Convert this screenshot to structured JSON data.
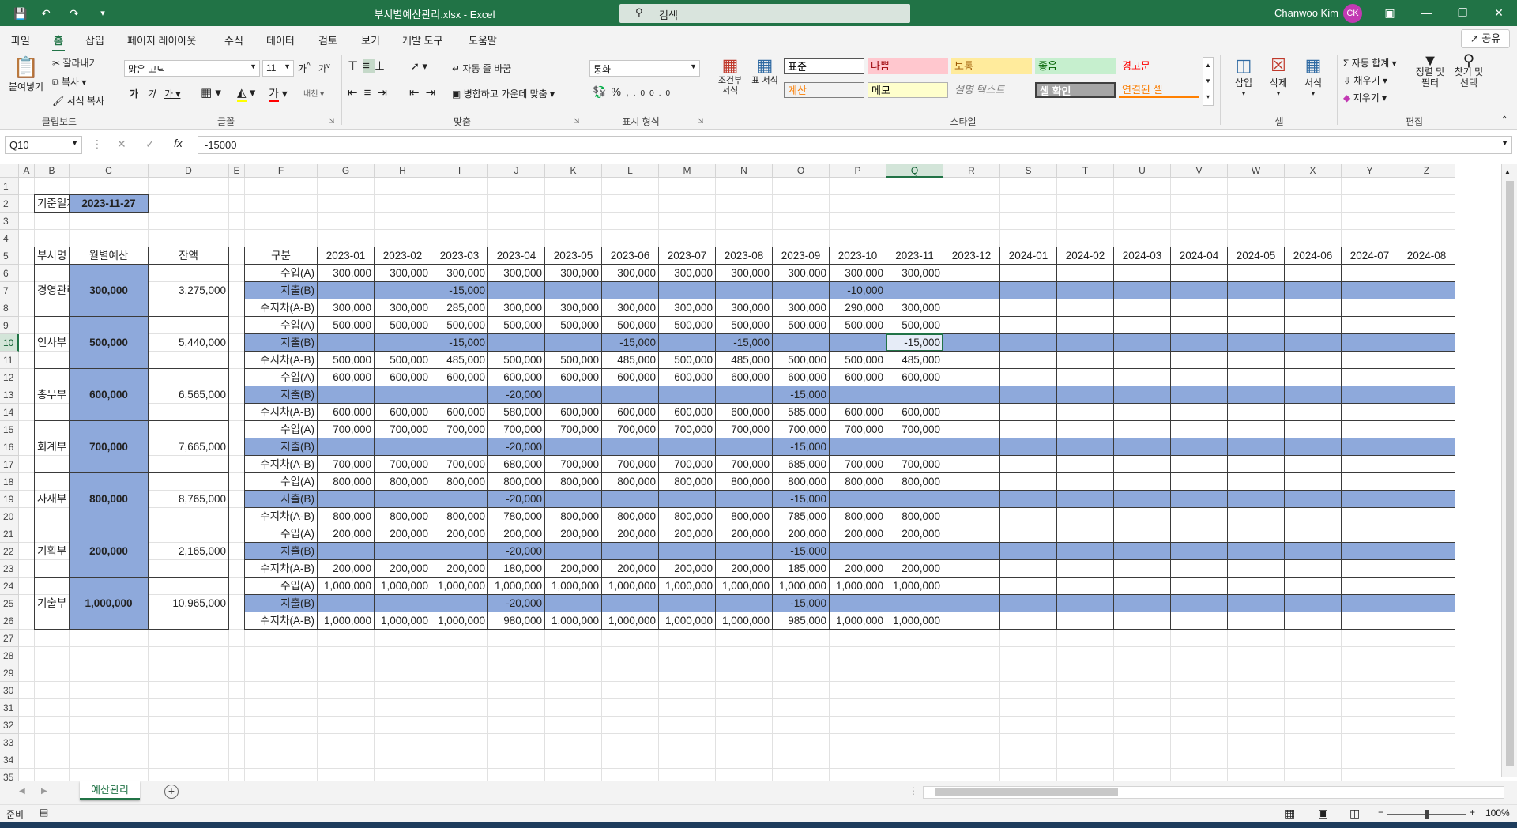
{
  "titlebar": {
    "title": "부서별예산관리.xlsx  -  Excel",
    "search_placeholder": "검색",
    "user_name": "Chanwoo Kim",
    "user_initials": "CK"
  },
  "ribbon_tabs": [
    "파일",
    "홈",
    "삽입",
    "페이지 레이아웃",
    "수식",
    "데이터",
    "검토",
    "보기",
    "개발 도구",
    "도움말"
  ],
  "share_label": "공유",
  "clipboard": {
    "paste": "붙여넣기",
    "cut": "잘라내기",
    "copy": "복사",
    "format_painter": "서식 복사",
    "label": "클립보드"
  },
  "font": {
    "name": "맑은 고딕",
    "size": "11",
    "label": "글꼴"
  },
  "alignment": {
    "wrap": "자동 줄 바꿈",
    "merge": "병합하고 가운데 맞춤",
    "label": "맞춤"
  },
  "number": {
    "format": "통화",
    "label": "표시 형식"
  },
  "styles": {
    "conditional": "조건부 서식",
    "table": "표 서식",
    "label": "스타일",
    "cells": [
      {
        "text": "표준",
        "bg": "#ffffff",
        "color": "#000000"
      },
      {
        "text": "나쁨",
        "bg": "#ffc7ce",
        "color": "#9c0006"
      },
      {
        "text": "보통",
        "bg": "#ffeb9c",
        "color": "#9c5700"
      },
      {
        "text": "좋음",
        "bg": "#c6efce",
        "color": "#006100"
      },
      {
        "text": "경고문",
        "bg": "#f3f3f3",
        "color": "#ff0000"
      },
      {
        "text": "계산",
        "bg": "#f2f2f2",
        "color": "#fa7d00"
      },
      {
        "text": "메모",
        "bg": "#ffffcc",
        "color": "#000000"
      },
      {
        "text": "설명 텍스트",
        "bg": "#f3f3f3",
        "color": "#7f7f7f"
      },
      {
        "text": "셀 확인",
        "bg": "#a5a5a5",
        "color": "#ffffff"
      },
      {
        "text": "연결된 셀",
        "bg": "#f3f3f3",
        "color": "#fa7d00"
      }
    ]
  },
  "cells_group": {
    "insert": "삽입",
    "delete": "삭제",
    "format": "서식",
    "label": "셀"
  },
  "editing": {
    "autosum": "자동 합계",
    "fill": "채우기",
    "clear": "지우기",
    "sort": "정렬 및 필터",
    "find": "찾기 및 선택",
    "label": "편집"
  },
  "formula_bar": {
    "name_box": "Q10",
    "formula": "-15000"
  },
  "columns": [
    "A",
    "B",
    "C",
    "D",
    "E",
    "F",
    "G",
    "H",
    "I",
    "J",
    "K",
    "L",
    "M",
    "N",
    "O",
    "P",
    "Q",
    "R",
    "S",
    "T",
    "U",
    "V",
    "W",
    "X",
    "Y",
    "Z"
  ],
  "rows": [
    "1",
    "2",
    "3",
    "4",
    "5",
    "6",
    "7",
    "8",
    "9",
    "10",
    "11",
    "12",
    "13",
    "14",
    "15",
    "16",
    "17",
    "18",
    "19",
    "20",
    "21",
    "22",
    "23",
    "24",
    "25",
    "26",
    "27",
    "28",
    "29",
    "30",
    "31",
    "32",
    "33",
    "34",
    "35"
  ],
  "sheet": {
    "base_date_label": "기준일자",
    "base_date": "2023-11-27",
    "left_headers": [
      "부서명",
      "월별예산",
      "잔액"
    ],
    "gubun_header": "구분",
    "months": [
      "2023-01",
      "2023-02",
      "2023-03",
      "2023-04",
      "2023-05",
      "2023-06",
      "2023-07",
      "2023-08",
      "2023-09",
      "2023-10",
      "2023-11",
      "2023-12",
      "2024-01",
      "2024-02",
      "2024-03",
      "2024-04",
      "2024-05",
      "2024-06",
      "2024-07",
      "2024-08"
    ],
    "row_labels": [
      "수입(A)",
      "지출(B)",
      "수지차(A-B)"
    ],
    "departments": [
      {
        "name": "경영관리부",
        "budget": "300,000",
        "balance": "3,275,000",
        "income": [
          "300,000",
          "300,000",
          "300,000",
          "300,000",
          "300,000",
          "300,000",
          "300,000",
          "300,000",
          "300,000",
          "300,000",
          "300,000"
        ],
        "expense": [
          "",
          "",
          "-15,000",
          "",
          "",
          "",
          "",
          "",
          "",
          "-10,000",
          ""
        ],
        "diff": [
          "300,000",
          "300,000",
          "285,000",
          "300,000",
          "300,000",
          "300,000",
          "300,000",
          "300,000",
          "300,000",
          "290,000",
          "300,000"
        ]
      },
      {
        "name": "인사부",
        "budget": "500,000",
        "balance": "5,440,000",
        "income": [
          "500,000",
          "500,000",
          "500,000",
          "500,000",
          "500,000",
          "500,000",
          "500,000",
          "500,000",
          "500,000",
          "500,000",
          "500,000"
        ],
        "expense": [
          "",
          "",
          "-15,000",
          "",
          "",
          "-15,000",
          "",
          "-15,000",
          "",
          "",
          "-15,000"
        ],
        "diff": [
          "500,000",
          "500,000",
          "485,000",
          "500,000",
          "500,000",
          "485,000",
          "500,000",
          "485,000",
          "500,000",
          "500,000",
          "485,000"
        ]
      },
      {
        "name": "총무부",
        "budget": "600,000",
        "balance": "6,565,000",
        "income": [
          "600,000",
          "600,000",
          "600,000",
          "600,000",
          "600,000",
          "600,000",
          "600,000",
          "600,000",
          "600,000",
          "600,000",
          "600,000"
        ],
        "expense": [
          "",
          "",
          "",
          "-20,000",
          "",
          "",
          "",
          "",
          "-15,000",
          "",
          ""
        ],
        "diff": [
          "600,000",
          "600,000",
          "600,000",
          "580,000",
          "600,000",
          "600,000",
          "600,000",
          "600,000",
          "585,000",
          "600,000",
          "600,000"
        ]
      },
      {
        "name": "회계부",
        "budget": "700,000",
        "balance": "7,665,000",
        "income": [
          "700,000",
          "700,000",
          "700,000",
          "700,000",
          "700,000",
          "700,000",
          "700,000",
          "700,000",
          "700,000",
          "700,000",
          "700,000"
        ],
        "expense": [
          "",
          "",
          "",
          "-20,000",
          "",
          "",
          "",
          "",
          "-15,000",
          "",
          ""
        ],
        "diff": [
          "700,000",
          "700,000",
          "700,000",
          "680,000",
          "700,000",
          "700,000",
          "700,000",
          "700,000",
          "685,000",
          "700,000",
          "700,000"
        ]
      },
      {
        "name": "자재부",
        "budget": "800,000",
        "balance": "8,765,000",
        "income": [
          "800,000",
          "800,000",
          "800,000",
          "800,000",
          "800,000",
          "800,000",
          "800,000",
          "800,000",
          "800,000",
          "800,000",
          "800,000"
        ],
        "expense": [
          "",
          "",
          "",
          "-20,000",
          "",
          "",
          "",
          "",
          "-15,000",
          "",
          ""
        ],
        "diff": [
          "800,000",
          "800,000",
          "800,000",
          "780,000",
          "800,000",
          "800,000",
          "800,000",
          "800,000",
          "785,000",
          "800,000",
          "800,000"
        ]
      },
      {
        "name": "기획부",
        "budget": "200,000",
        "balance": "2,165,000",
        "income": [
          "200,000",
          "200,000",
          "200,000",
          "200,000",
          "200,000",
          "200,000",
          "200,000",
          "200,000",
          "200,000",
          "200,000",
          "200,000"
        ],
        "expense": [
          "",
          "",
          "",
          "-20,000",
          "",
          "",
          "",
          "",
          "-15,000",
          "",
          ""
        ],
        "diff": [
          "200,000",
          "200,000",
          "200,000",
          "180,000",
          "200,000",
          "200,000",
          "200,000",
          "200,000",
          "185,000",
          "200,000",
          "200,000"
        ]
      },
      {
        "name": "기술부",
        "budget": "1,000,000",
        "balance": "10,965,000",
        "income": [
          "1,000,000",
          "1,000,000",
          "1,000,000",
          "1,000,000",
          "1,000,000",
          "1,000,000",
          "1,000,000",
          "1,000,000",
          "1,000,000",
          "1,000,000",
          "1,000,000"
        ],
        "expense": [
          "",
          "",
          "",
          "-20,000",
          "",
          "",
          "",
          "",
          "-15,000",
          "",
          ""
        ],
        "diff": [
          "1,000,000",
          "1,000,000",
          "1,000,000",
          "980,000",
          "1,000,000",
          "1,000,000",
          "1,000,000",
          "1,000,000",
          "985,000",
          "1,000,000",
          "1,000,000"
        ]
      }
    ]
  },
  "sheet_tabs": [
    "예산관리"
  ],
  "status": {
    "ready": "준비",
    "zoom": "100%"
  },
  "colors": {
    "accent": "#217346",
    "highlight_blue": "#8ea9db"
  }
}
